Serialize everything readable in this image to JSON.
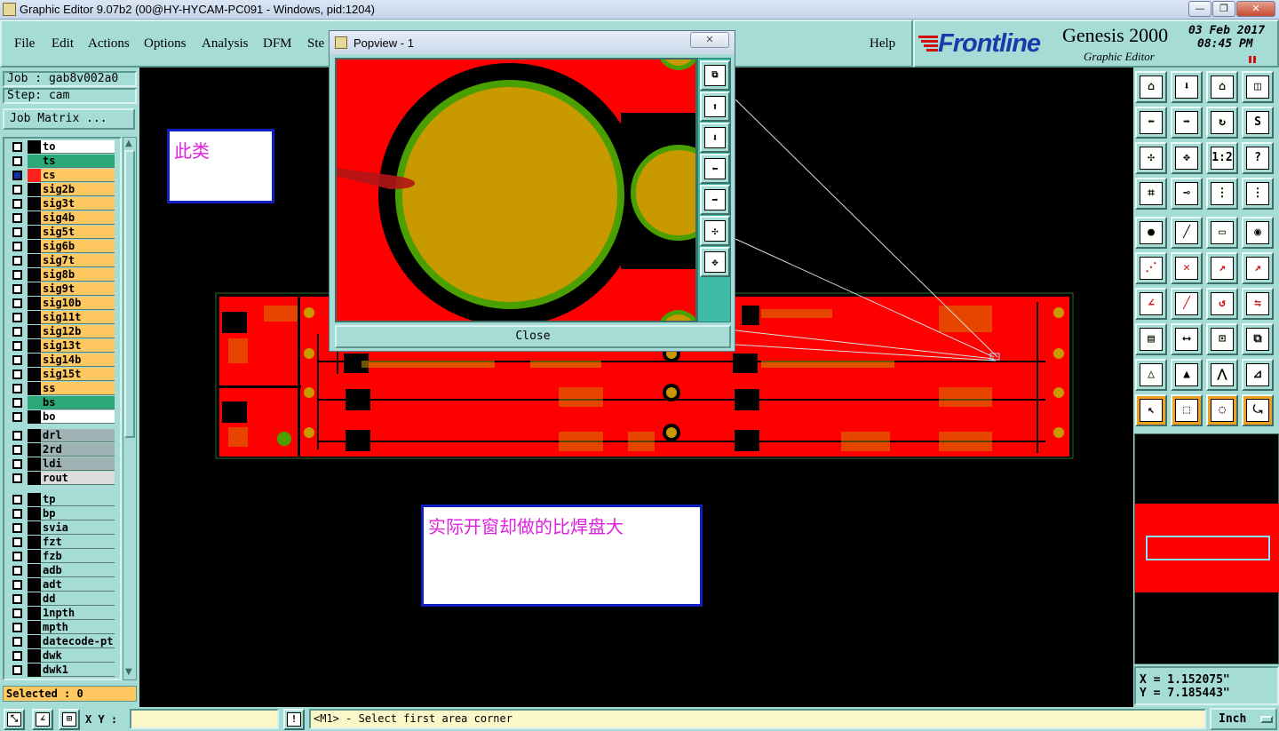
{
  "window": {
    "title": "Graphic Editor 9.07b2 (00@HY-HYCAM-PC091 - Windows, pid:1204)",
    "minimize_glyph": "—",
    "maximize_glyph": "❐",
    "close_glyph": "✕"
  },
  "menu": {
    "items": [
      "File",
      "Edit",
      "Actions",
      "Options",
      "Analysis",
      "DFM",
      "Ste"
    ],
    "help": "Help"
  },
  "brand": {
    "logo": "Frontline",
    "product": "Genesis 2000",
    "subtitle": "Graphic Editor",
    "date": "03 Feb 2017",
    "time": "08:45 PM"
  },
  "job": {
    "job_label": "Job : gab8v002a0",
    "step_label": "Step: cam",
    "matrix_button": "Job Matrix ..."
  },
  "layers": [
    {
      "name": "to",
      "color": "#ffffff"
    },
    {
      "name": "ts",
      "color": "#2aa877"
    },
    {
      "name": "cs",
      "color": "#ffc860"
    },
    {
      "name": "sig2b",
      "color": "#ffc860"
    },
    {
      "name": "sig3t",
      "color": "#ffc860"
    },
    {
      "name": "sig4b",
      "color": "#ffc860"
    },
    {
      "name": "sig5t",
      "color": "#ffc860"
    },
    {
      "name": "sig6b",
      "color": "#ffc860"
    },
    {
      "name": "sig7t",
      "color": "#ffc860"
    },
    {
      "name": "sig8b",
      "color": "#ffc860"
    },
    {
      "name": "sig9t",
      "color": "#ffc860"
    },
    {
      "name": "sig10b",
      "color": "#ffc860"
    },
    {
      "name": "sig11t",
      "color": "#ffc860"
    },
    {
      "name": "sig12b",
      "color": "#ffc860"
    },
    {
      "name": "sig13t",
      "color": "#ffc860"
    },
    {
      "name": "sig14b",
      "color": "#ffc860"
    },
    {
      "name": "sig15t",
      "color": "#ffc860"
    },
    {
      "name": "ss",
      "color": "#ffc860"
    },
    {
      "name": "bs",
      "color": "#2aa877"
    },
    {
      "name": "bo",
      "color": "#ffffff"
    },
    {
      "name": "drl",
      "color": "#9fb2b4"
    },
    {
      "name": "2rd",
      "color": "#9fb2b4"
    },
    {
      "name": "ldi",
      "color": "#9fb2b4"
    },
    {
      "name": "rout",
      "color": "#dcdcdc"
    },
    {
      "name": "tp",
      "color": "#a6dcd6"
    },
    {
      "name": "bp",
      "color": "#a6dcd6"
    },
    {
      "name": "svia",
      "color": "#a6dcd6"
    },
    {
      "name": "fzt",
      "color": "#a6dcd6"
    },
    {
      "name": "fzb",
      "color": "#a6dcd6"
    },
    {
      "name": "adb",
      "color": "#a6dcd6"
    },
    {
      "name": "adt",
      "color": "#a6dcd6"
    },
    {
      "name": "dd",
      "color": "#a6dcd6"
    },
    {
      "name": "1npth",
      "color": "#a6dcd6"
    },
    {
      "name": "mpth",
      "color": "#a6dcd6"
    },
    {
      "name": "datecode-pt",
      "color": "#a6dcd6"
    },
    {
      "name": "dwk",
      "color": "#a6dcd6"
    },
    {
      "name": "dwk1",
      "color": "#a6dcd6"
    }
  ],
  "selected": "Selected : 0",
  "popview": {
    "title": "Popview - 1",
    "close_label": "Close"
  },
  "annotations": {
    "small": "此类",
    "large": "实际开窗却做的比焊盘大"
  },
  "coordinates": {
    "x": "X = 1.152075\"",
    "y": "Y = 7.185443\""
  },
  "status": {
    "xy_label": "X Y :",
    "message": "<M1> - Select first area corner",
    "units": "Inch"
  },
  "colors": {
    "panel": "#a6dcd6",
    "copper": "#ff0000",
    "pad": "#c89a00",
    "mask_ring": "#4aa000",
    "annotation_text": "#e020e0",
    "annotation_border": "#1020c0"
  }
}
